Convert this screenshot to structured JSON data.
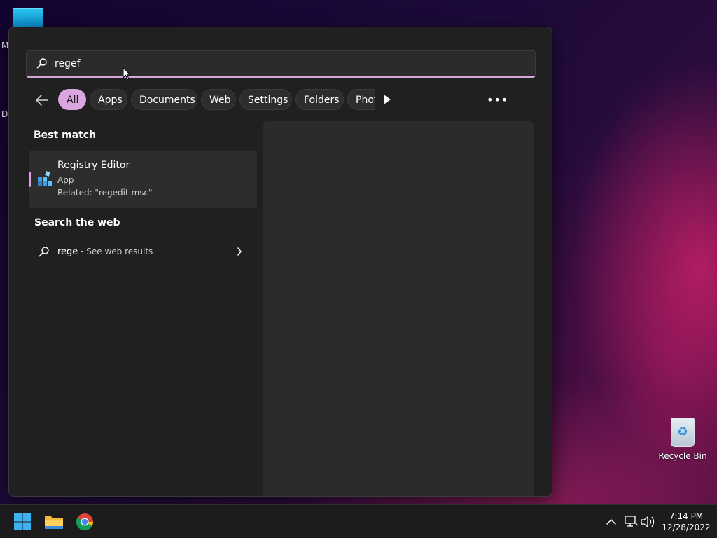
{
  "desktop": {
    "left_labels": [
      "M",
      "D"
    ],
    "recycle_bin_label": "Recycle Bin"
  },
  "search": {
    "value": "regef",
    "placeholder": ""
  },
  "filters": {
    "items": [
      {
        "label": "All",
        "active": true
      },
      {
        "label": "Apps",
        "active": false
      },
      {
        "label": "Documents",
        "active": false
      },
      {
        "label": "Web",
        "active": false
      },
      {
        "label": "Settings",
        "active": false
      },
      {
        "label": "Folders",
        "active": false
      },
      {
        "label": "Phot",
        "active": false
      }
    ]
  },
  "best_match": {
    "title": "Best match",
    "name": "Registry Editor",
    "type": "App",
    "related": "Related: \"regedit.msc\""
  },
  "web_search": {
    "title": "Search the web",
    "query": "rege",
    "suffix": " - See web results"
  },
  "taskbar": {
    "time": "7:14 PM",
    "date": "12/28/2022"
  },
  "colors": {
    "accent": "#dba5df",
    "panel_bg": "#202020",
    "taskbar_bg": "#1c1c1c"
  }
}
